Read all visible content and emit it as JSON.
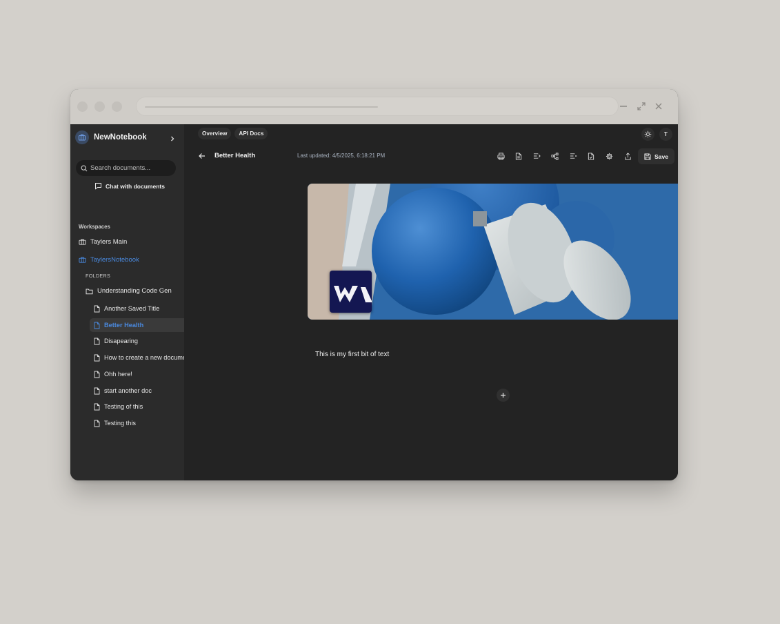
{
  "sidebar": {
    "workspace_name": "NewNotebook",
    "search_placeholder": "Search documents...",
    "chat_label": "Chat with documents",
    "workspaces_label": "Workspaces",
    "workspaces": [
      {
        "label": "Taylers Main",
        "active": false
      },
      {
        "label": "TaylersNotebook",
        "active": true
      }
    ],
    "folders_label": "FOLDERS",
    "folder_name": "Understanding Code Gen",
    "documents": [
      {
        "label": "Another Saved Title"
      },
      {
        "label": "Better Health"
      },
      {
        "label": "Disapearing"
      },
      {
        "label": "How to create a new document"
      },
      {
        "label": "Ohh here!"
      },
      {
        "label": "start another doc"
      },
      {
        "label": "Testing of this"
      },
      {
        "label": "Testing this"
      }
    ]
  },
  "header": {
    "tabs": [
      {
        "label": "Overview"
      },
      {
        "label": "API Docs"
      }
    ],
    "avatar_initial": "T"
  },
  "document": {
    "title": "Better Health",
    "last_updated": "Last updated: 4/5/2025, 6:18:21 PM",
    "save_label": "Save",
    "body_text": "This is my first bit of text"
  },
  "toolbar_icons": [
    "print-icon",
    "document-icon",
    "indent-icon",
    "workflow-icon",
    "outdent-icon",
    "file-check-icon",
    "gear-icon",
    "share-icon"
  ],
  "colors": {
    "accent": "#4a8ae0",
    "sidebar_bg": "#2b2b2b",
    "main_bg": "#232323",
    "logo_bg": "#141752"
  }
}
